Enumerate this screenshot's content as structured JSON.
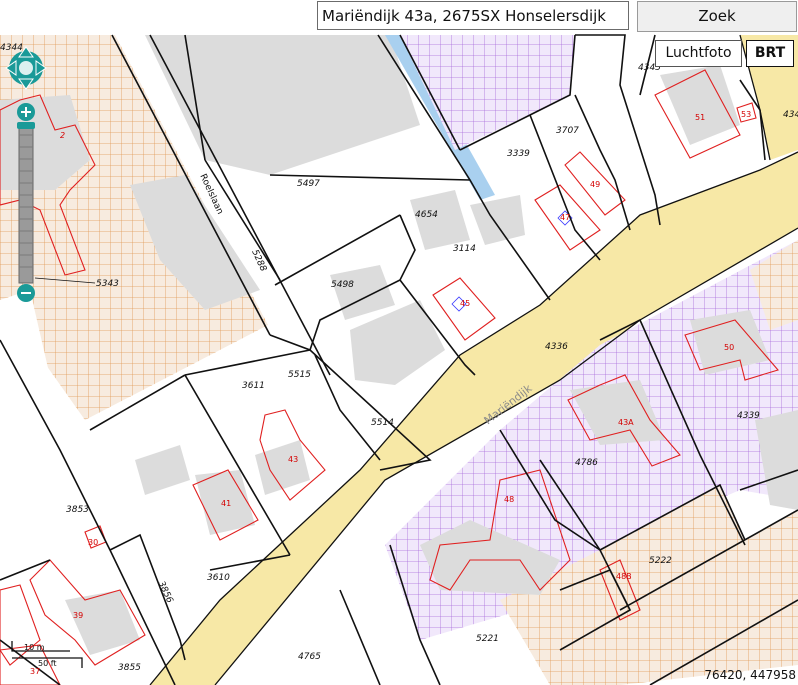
{
  "search": {
    "value": "Mariëndijk 43a, 2675SX Honselersdijk",
    "button_label": "Zoek"
  },
  "layers": {
    "aerial_label": "Luchtfoto",
    "brt_label": "BRT",
    "active": "BRT"
  },
  "coordinates": "76420, 447958",
  "scale": {
    "metric_label": "10 m",
    "imperial_label": "50 ft"
  },
  "streets": [
    {
      "name": "Mariëndijk"
    },
    {
      "name": "Roelslaan"
    }
  ],
  "parcels": [
    "4344",
    "2",
    "5497",
    "5343",
    "5288",
    "4654",
    "3114",
    "5498",
    "3707",
    "3339",
    "4345",
    "434",
    "5515",
    "5514",
    "3611",
    "4336",
    "4339",
    "4786",
    "3853",
    "3856",
    "3610",
    "5222",
    "5221",
    "4765",
    "3855"
  ],
  "house_numbers": [
    "51",
    "53",
    "49",
    "47",
    "45",
    "43",
    "41",
    "50",
    "43A",
    "48",
    "48B",
    "39",
    "37",
    "30"
  ],
  "colors": {
    "road_fill": "#f7e8a6",
    "water": "#a9d0ef",
    "building_fill": "#d9d9d9",
    "building_outline": "#e02020",
    "parcel_line": "#111111",
    "grid_orange": "#e09a55",
    "grid_purple": "#a86bdc",
    "nav_teal": "#1a9a98"
  }
}
